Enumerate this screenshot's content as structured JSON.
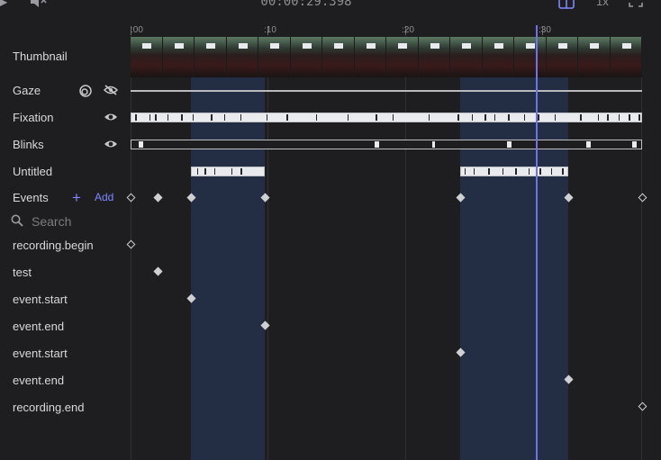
{
  "header": {
    "timecode": "00:00:29.398",
    "speed": "1x"
  },
  "ruler": {
    "ticks": [
      {
        "label": ":00",
        "pos": 0
      },
      {
        "label": ":10",
        "pos": 10
      },
      {
        "label": ":20",
        "pos": 20
      },
      {
        "label": ":30",
        "pos": 30
      }
    ]
  },
  "tracks": {
    "thumbnail_label": "Thumbnail",
    "gaze_label": "Gaze",
    "fixation_label": "Fixation",
    "blinks_label": "Blinks",
    "untitled_label": "Untitled",
    "events_label": "Events"
  },
  "events_panel": {
    "add_label": "Add",
    "search_placeholder": "Search",
    "items": [
      {
        "name": "recording.begin"
      },
      {
        "name": "test"
      },
      {
        "name": "event.start"
      },
      {
        "name": "event.end"
      },
      {
        "name": "event.start"
      },
      {
        "name": "event.end"
      },
      {
        "name": "recording.end"
      }
    ]
  },
  "colors": {
    "accent": "#7f86ff",
    "playhead": "#6f72e8",
    "segment": "#232e45"
  },
  "icons": [
    "volume-mute-icon",
    "split-view-icon",
    "fullscreen-icon",
    "circle-overlap-icon",
    "eye-off-icon",
    "eye-icon",
    "plus-icon",
    "search-icon"
  ]
}
